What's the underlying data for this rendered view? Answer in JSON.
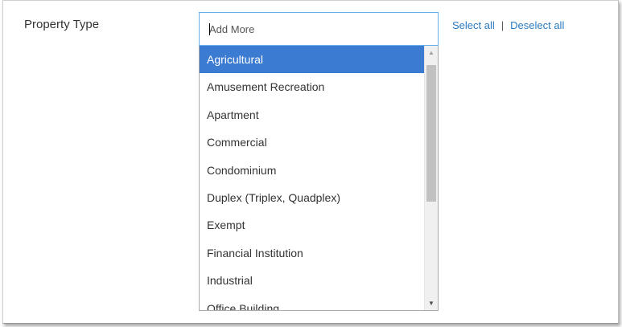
{
  "field": {
    "label": "Property Type",
    "input_placeholder": "Add More",
    "select_all": "Select all",
    "separator": "|",
    "deselect_all": "Deselect all"
  },
  "dropdown": {
    "options": [
      "Agricultural",
      "Amusement Recreation",
      "Apartment",
      "Commercial",
      "Condominium",
      "Duplex (Triplex, Quadplex)",
      "Exempt",
      "Financial Institution",
      "Industrial",
      "Office Building"
    ],
    "highlighted_option": "Agricultural"
  },
  "scrollbar": {
    "up_icon": "▲",
    "down_icon": "▼"
  },
  "colors": {
    "highlight": "#3b7bd1",
    "link": "#2a7bc1",
    "input_focus_border": "#66afe9"
  }
}
